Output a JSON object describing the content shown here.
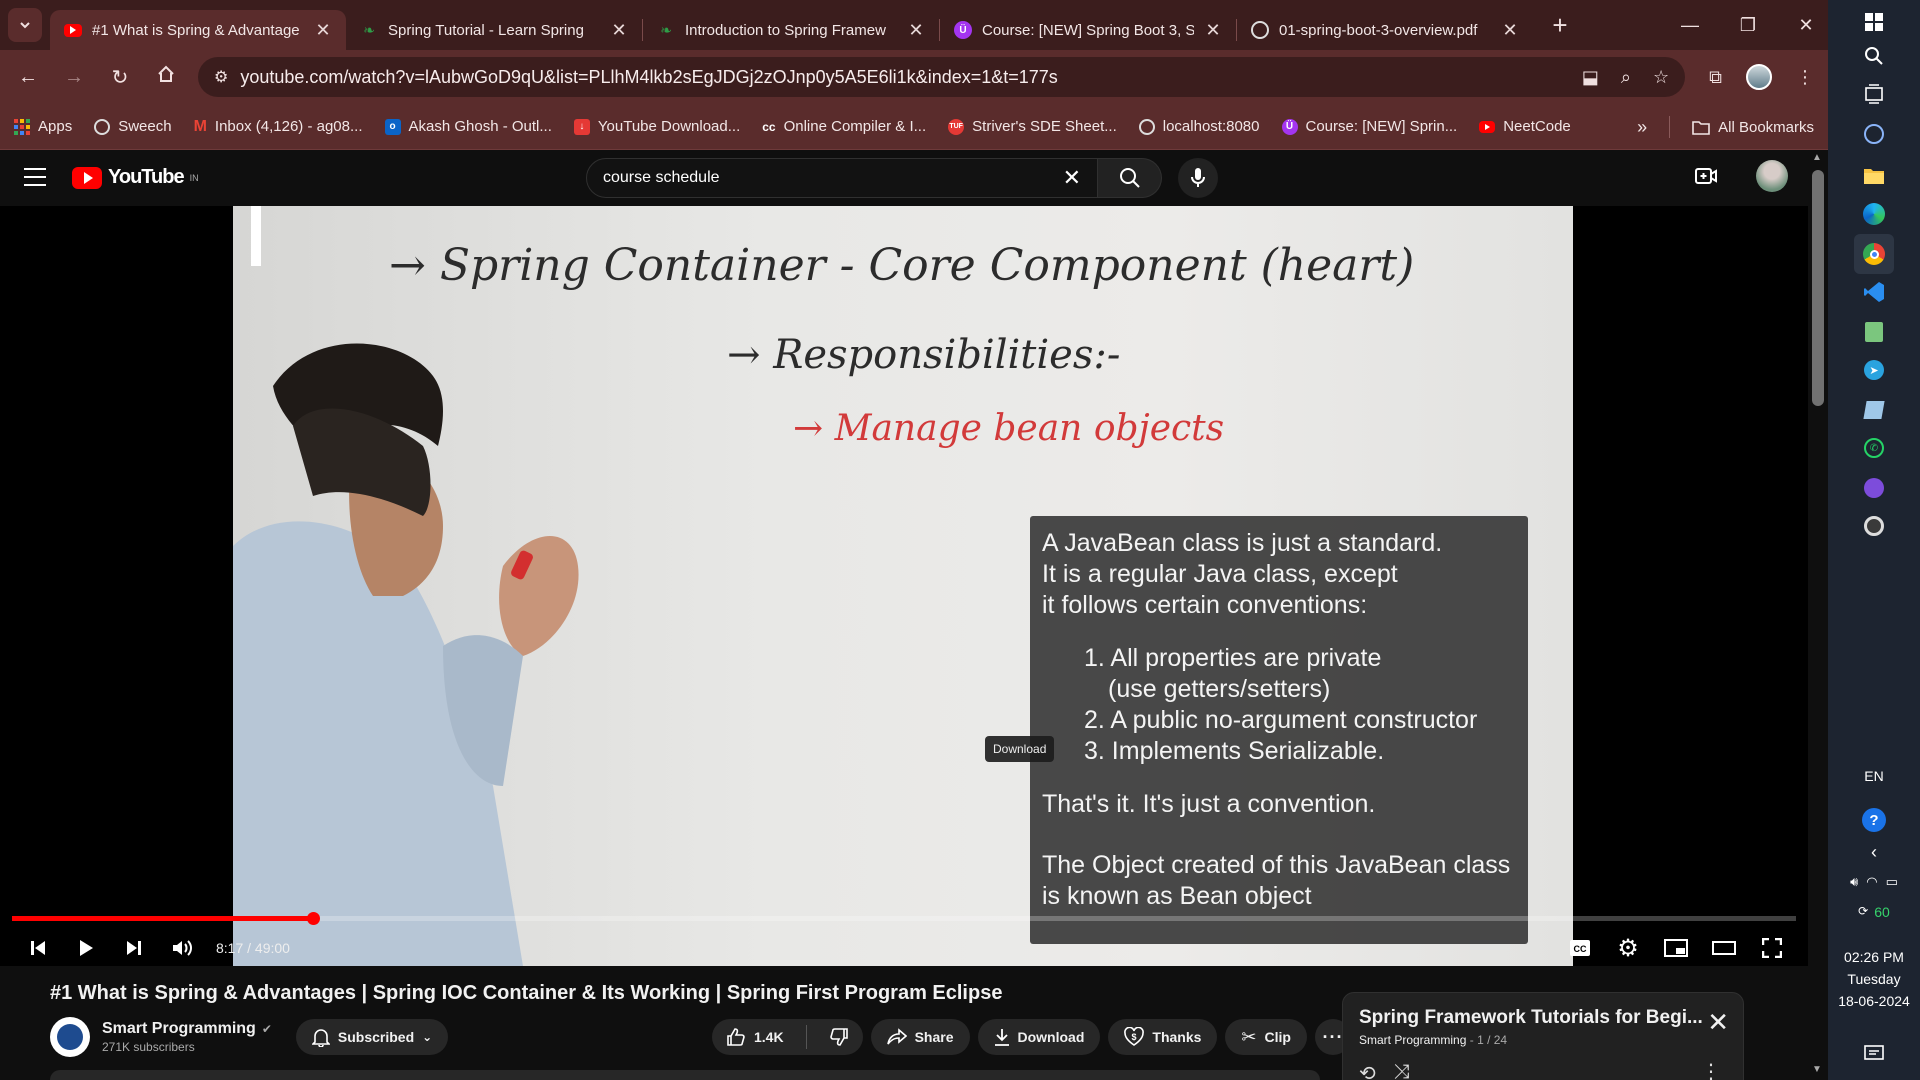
{
  "browser": {
    "tabs": [
      {
        "title": "#1 What is Spring & Advantage",
        "favicon": "youtube-icon",
        "active": true
      },
      {
        "title": "Spring Tutorial - Learn Spring",
        "favicon": "spring-leaf-icon",
        "active": false
      },
      {
        "title": "Introduction to Spring Framew",
        "favicon": "spring-leaf-icon",
        "active": false
      },
      {
        "title": "Course: [NEW] Spring Boot 3, S",
        "favicon": "udemy-icon",
        "active": false
      },
      {
        "title": "01-spring-boot-3-overview.pdf",
        "favicon": "globe-icon",
        "active": false
      }
    ],
    "url": "youtube.com/watch?v=lAubwGoD9qU&list=PLlhM4lkb2sEgJDGj2zOJnp0y5A5E6li1k&index=1&t=177s",
    "bookmarks": [
      {
        "label": "Apps",
        "icon": "apps-grid-icon"
      },
      {
        "label": "Sweech",
        "icon": "globe-icon"
      },
      {
        "label": "Inbox (4,126) - ag08...",
        "icon": "gmail-icon"
      },
      {
        "label": "Akash Ghosh - Outl...",
        "icon": "outlook-icon"
      },
      {
        "label": "YouTube Download...",
        "icon": "download-icon"
      },
      {
        "label": "Online Compiler & I...",
        "icon": "cc-icon"
      },
      {
        "label": "Striver's SDE Sheet...",
        "icon": "tuf-icon"
      },
      {
        "label": "localhost:8080",
        "icon": "globe-icon"
      },
      {
        "label": "Course: [NEW] Sprin...",
        "icon": "udemy-icon"
      },
      {
        "label": "NeetCode",
        "icon": "youtube-icon"
      }
    ],
    "all_bookmarks": "All Bookmarks"
  },
  "youtube": {
    "logo_text": "YouTube",
    "region": "IN",
    "search_value": "course schedule",
    "video": {
      "whiteboard_line1": "→ Spring Container - Core Component (heart)",
      "whiteboard_line2": "→ Responsibilities:-",
      "whiteboard_line3": "→ Manage bean objects",
      "caption_intro": [
        "A JavaBean class is just a standard.",
        "It is a regular Java class, except",
        "it follows certain conventions:"
      ],
      "caption_list": [
        "1. All properties are private",
        "(use getters/setters)",
        "2. A public no-argument constructor",
        "3. Implements Serializable."
      ],
      "caption_convention": "That's it. It's just a convention.",
      "caption_bean": [
        "The Object created of this JavaBean class",
        "is known as Bean object"
      ],
      "time_display": "8:17 / 49:00",
      "progress_fraction": 0.169,
      "tooltip": "Download"
    },
    "title": "#1 What is Spring & Advantages | Spring IOC Container & Its Working | Spring First Program Eclipse",
    "channel": {
      "name": "Smart Programming",
      "subscribers": "271K subscribers",
      "subscribe_label": "Subscribed"
    },
    "actions": {
      "likes": "1.4K",
      "share": "Share",
      "download": "Download",
      "thanks": "Thanks",
      "clip": "Clip"
    },
    "playlist": {
      "title": "Spring Framework Tutorials for Begi...",
      "channel": "Smart Programming",
      "position": "1 / 24"
    }
  },
  "taskbar": {
    "language": "EN",
    "battery": "60",
    "time": "02:26 PM",
    "day": "Tuesday",
    "date": "18-06-2024"
  }
}
